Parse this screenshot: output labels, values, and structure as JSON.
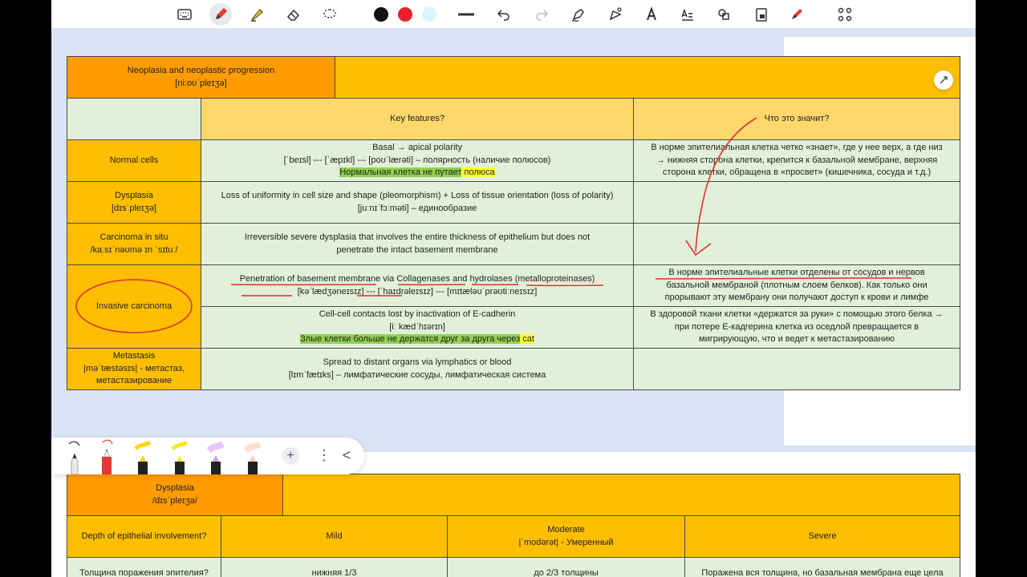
{
  "toolbar": {
    "tools": [
      "keyboard-icon",
      "pen-icon",
      "highlighter-icon",
      "eraser-icon",
      "lasso-icon",
      "color-black",
      "color-red",
      "color-light-cyan",
      "stroke-width-icon",
      "undo-icon",
      "redo-icon",
      "shape-pen-icon",
      "shape-icon",
      "text-style-icon",
      "text-recognition-icon",
      "shapes-icon",
      "lock-icon",
      "red-pen-icon",
      "grid-icon"
    ],
    "colors": {
      "black": "#111111",
      "red": "#e8202a",
      "light_cyan": "#d9f7fb"
    }
  },
  "table1": {
    "title": "Neoplasia and neoplastic progression",
    "title_ipa": "[niːoʊˈpleɪʒə]",
    "col_key": "Key features?",
    "col_meaning": "Что это значит?",
    "rows": [
      {
        "name": "Normal cells",
        "f1": "Basal → apical polarity",
        "f2": "[ˈbeɪsl] --- [ˈæpɪkl] --- [poʊˈlærəti] – полярность (наличие полюсов)",
        "f3a": "Нормальная клетка не путает",
        "f3b": " полюса",
        "m1": "В норме эпителиальная клетка четко «знает», где у нее верх, а где низ",
        "m2": "→ нижняя сторона клетки, крепится к базальной мембране, верхняя",
        "m3": "сторона клетки, обращена в «просвет» (кишечника, сосуда и т.д.)"
      },
      {
        "name": "Dysplasia",
        "name_ipa": "[dɪsˈpleɪʒə]",
        "f1": "Loss of uniformity in cell size and shape (pleomorphism) + Loss of tissue orientation (loss of polarity)",
        "f2": "[juːnɪˈfɔːməti] – единообразие"
      },
      {
        "name": "Carcinoma in situ",
        "name_ipa": "/kaːsɪˈnəʊmə ɪn ˈsɪtuː/",
        "f1": "Irreversible severe dysplasia that involves the entire thickness of epithelium but does not",
        "f2": "penetrate the intact basement membrane"
      },
      {
        "name": "Invasive carcinoma",
        "f1": "Penetration of basement membrane via Collagenases and hydrolases (metalloproteinases)",
        "f2": "[kəˈlædʒəneɪsɪz] --- [ˈhaɪdrəleɪsɪz] --- [mɪtæləʊˈprəʊtiːneɪsɪz]",
        "m1": "В норме эпителиальные клетки отделены от сосудов и нервов",
        "m2": "базальной мембраной (плотным слоем белков). Как только они",
        "m3": "прорывают эту мембрану они получают доступ к крови и лимфе",
        "g1": "Cell-cell contacts lost by inactivation of E-cadherin",
        "g2": "[iː kædˈhɪərɪn]",
        "g3a": "Злые клетки больше не держатся друг за друга через",
        "g3b": " cat",
        "n1": "В здоровой ткани клетки «держатся за руки» с помощью этого белка →",
        "n2": "при потере E-кадгерина клетка из оседлой превращается в",
        "n3": "мигрирующую, что и ведет к метастазированию"
      },
      {
        "name": "Metastasis",
        "name_ipa": "|məˈtæstəsɪs| - метастаз,",
        "name_ru": "метастазирование",
        "f1": "Spread to distant organs via lymphatics or blood",
        "f2": "[lɪmˈfætɪks] – лимфатические сосуды, лимфатическая система"
      }
    ]
  },
  "table2": {
    "title": "Dysplasia",
    "title_ipa": "/dɪsˈpleɪʒə/",
    "row_label": "Depth of epithelial involvement?",
    "mild": "Mild",
    "moderate": "Moderate",
    "moderate_ipa": "|ˈmodərət| - Умеренный",
    "severe": "Severe",
    "row2_label": "Толщина поражения эпителия?",
    "row2_mild": "нижняя 1/3",
    "row2_moderate": "до 2/3 толщины",
    "row2_severe": "Поражена вся толщина, но базальная мембрана еще цела"
  },
  "pen_palette": {
    "tools": [
      "fine-pen-black",
      "pen-red",
      "highlighter-yellow",
      "highlighter-yellow-2",
      "highlighter-purple",
      "highlighter-peach"
    ],
    "add": "+",
    "more": "⋮",
    "collapse": "<"
  },
  "annotation_color": "#e0302c"
}
